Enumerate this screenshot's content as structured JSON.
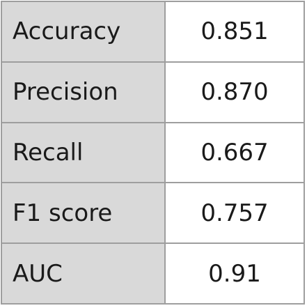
{
  "metrics": [
    {
      "label": "Accuracy",
      "value": "0.851"
    },
    {
      "label": "Precision",
      "value": "0.870"
    },
    {
      "label": "Recall",
      "value": "0.667"
    },
    {
      "label": "F1 score",
      "value": "0.757"
    },
    {
      "label": "AUC",
      "value": "0.91"
    }
  ],
  "colors": {
    "label_background": "#d9d9d9",
    "value_background": "#ffffff",
    "border": "#9e9e9e",
    "text": "#1a1a1a"
  }
}
